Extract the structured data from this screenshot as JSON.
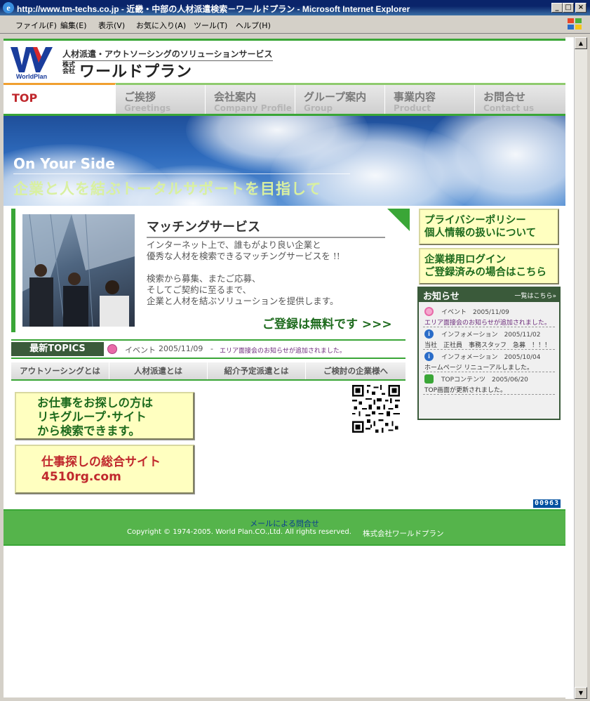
{
  "window": {
    "title": "http://www.tm-techs.co.jp - 近畿・中部の人材派遣検索－ワールドプラン - Microsoft Internet Explorer",
    "buttons": [
      "_",
      "□",
      "×"
    ]
  },
  "menu": [
    "ファイル(F)",
    "編集(E)",
    "表示(V)",
    "お気に入り(A)",
    "ツール(T)",
    "ヘルプ(H)"
  ],
  "header": {
    "logo_text": "WorldPlan",
    "tagline": "人材派遣・アウトソーシングのソリューションサービス",
    "company_prefix": "株式会社",
    "company_name": "ワールドプラン"
  },
  "nav": [
    {
      "jp": "TOP",
      "en": ""
    },
    {
      "jp": "ご挨拶",
      "en": "Greetings"
    },
    {
      "jp": "会社案内",
      "en": "Company Profile"
    },
    {
      "jp": "グループ案内",
      "en": "Group"
    },
    {
      "jp": "事業内容",
      "en": "Product"
    },
    {
      "jp": "お問合せ",
      "en": "Contact us"
    }
  ],
  "hero": {
    "line1": "On Your Side",
    "line2": "企業と人を結ぶトータルサポートを目指して"
  },
  "matching": {
    "heading": "マッチングサービス",
    "desc": "インターネット上で、誰もがより良い企業と\n優秀な人材を検索できるマッチングサービスを !!\n\n検索から募集、またご応募、\nそしてご契約に至るまで、\n企業と人材を結ぶソリューションを提供します。",
    "register": "ご登録は無料です >>>"
  },
  "topics": {
    "label": "最新TOPICS",
    "category": "イベント",
    "date": "2005/11/09",
    "dash": "-",
    "message": "エリア面接会のお知らせが追加されました。"
  },
  "subnav": [
    "アウトソーシングとは",
    "人材派遣とは",
    "紹介予定派遣とは",
    "ご検討の企業様へ"
  ],
  "job_buttons": [
    "お仕事をお探しの方は\nリキグループ･サイト\nから検索できます。",
    "仕事探しの総合サイト\n4510rg.com"
  ],
  "side_buttons": [
    "プライバシーポリシー\n個人情報の扱いについて",
    "企業様用ログイン\nご登録済みの場合はこちら"
  ],
  "news": {
    "title": "お知らせ",
    "all_link": "一覧はこちら»",
    "items": [
      {
        "category": "イベント",
        "date": "2005/11/09",
        "body": "エリア面接会のお知らせが追加されました。",
        "icon": "heart-icon",
        "color": "#e86aa8",
        "body_color": "#6b2a7a"
      },
      {
        "category": "インフォメーション",
        "date": "2005/11/02",
        "body": "当社　正社員　事務スタッフ　急募　！！！",
        "icon": "info-icon",
        "color": "#2a6cc8",
        "body_color": "#333333"
      },
      {
        "category": "インフォメーション",
        "date": "2005/10/04",
        "body": "ホームページ リニューアルしました。",
        "icon": "info-icon",
        "color": "#2a6cc8",
        "body_color": "#333333"
      },
      {
        "category": "TOPコンテンツ",
        "date": "2005/06/20",
        "body": "TOP画面が更新されました。",
        "icon": "square-icon",
        "color": "#3aa637",
        "body_color": "#333333"
      }
    ]
  },
  "counter": "00963",
  "footer": {
    "mail": "メールによる問合せ",
    "copyright": "Copyright © 1974-2005. World Plan.CO.,Ltd. All rights reserved.",
    "company": "株式会社ワールドプラン"
  },
  "colors": {
    "brand_green": "#3aa637",
    "dark_green": "#3a5a3a",
    "accent_red": "#c0282d",
    "button_yellow": "#ffffc0"
  }
}
